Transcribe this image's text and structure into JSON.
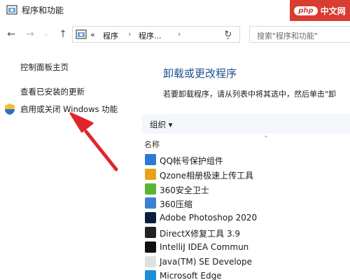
{
  "window": {
    "title": "程序和功能"
  },
  "watermark": {
    "badge": "php",
    "text": "中文网"
  },
  "address": {
    "overflow": "«",
    "crumb1": "程序",
    "crumb2": "程序..."
  },
  "search": {
    "placeholder": "搜索\"程序和功能\""
  },
  "sidebar": {
    "home": "控制面板主页",
    "updates": "查看已安装的更新",
    "features": "启用或关闭 Windows 功能"
  },
  "main": {
    "heading": "卸载或更改程序",
    "description": "若要卸载程序，请从列表中将其选中，然后单击\"卸",
    "toolbar_organize": "组织 ▾",
    "column_name": "名称"
  },
  "programs": [
    {
      "name": "QQ帐号保护组件",
      "icon": "qq-guard-icon",
      "color": "#2f79d6"
    },
    {
      "name": "Qzone相册极速上传工具",
      "icon": "qzone-icon",
      "color": "#e8a21a"
    },
    {
      "name": "360安全卫士",
      "icon": "360-safe-icon",
      "color": "#5bb535"
    },
    {
      "name": "360压缩",
      "icon": "360-zip-icon",
      "color": "#3f7fd3"
    },
    {
      "name": "Adobe Photoshop 2020",
      "icon": "photoshop-icon",
      "color": "#0b1e3b"
    },
    {
      "name": "DirectX修复工具 3.9",
      "icon": "directx-icon",
      "color": "#222222"
    },
    {
      "name": "IntelliJ IDEA Commun",
      "icon": "intellij-icon",
      "color": "#111111"
    },
    {
      "name": "Java(TM) SE Develope",
      "icon": "java-icon",
      "color": "#e0e0e0"
    },
    {
      "name": "Microsoft Edge",
      "icon": "edge-icon",
      "color": "#1d8fd8"
    }
  ],
  "accent": {
    "link": "#1e4e8c",
    "arrow": "#e0262b"
  }
}
